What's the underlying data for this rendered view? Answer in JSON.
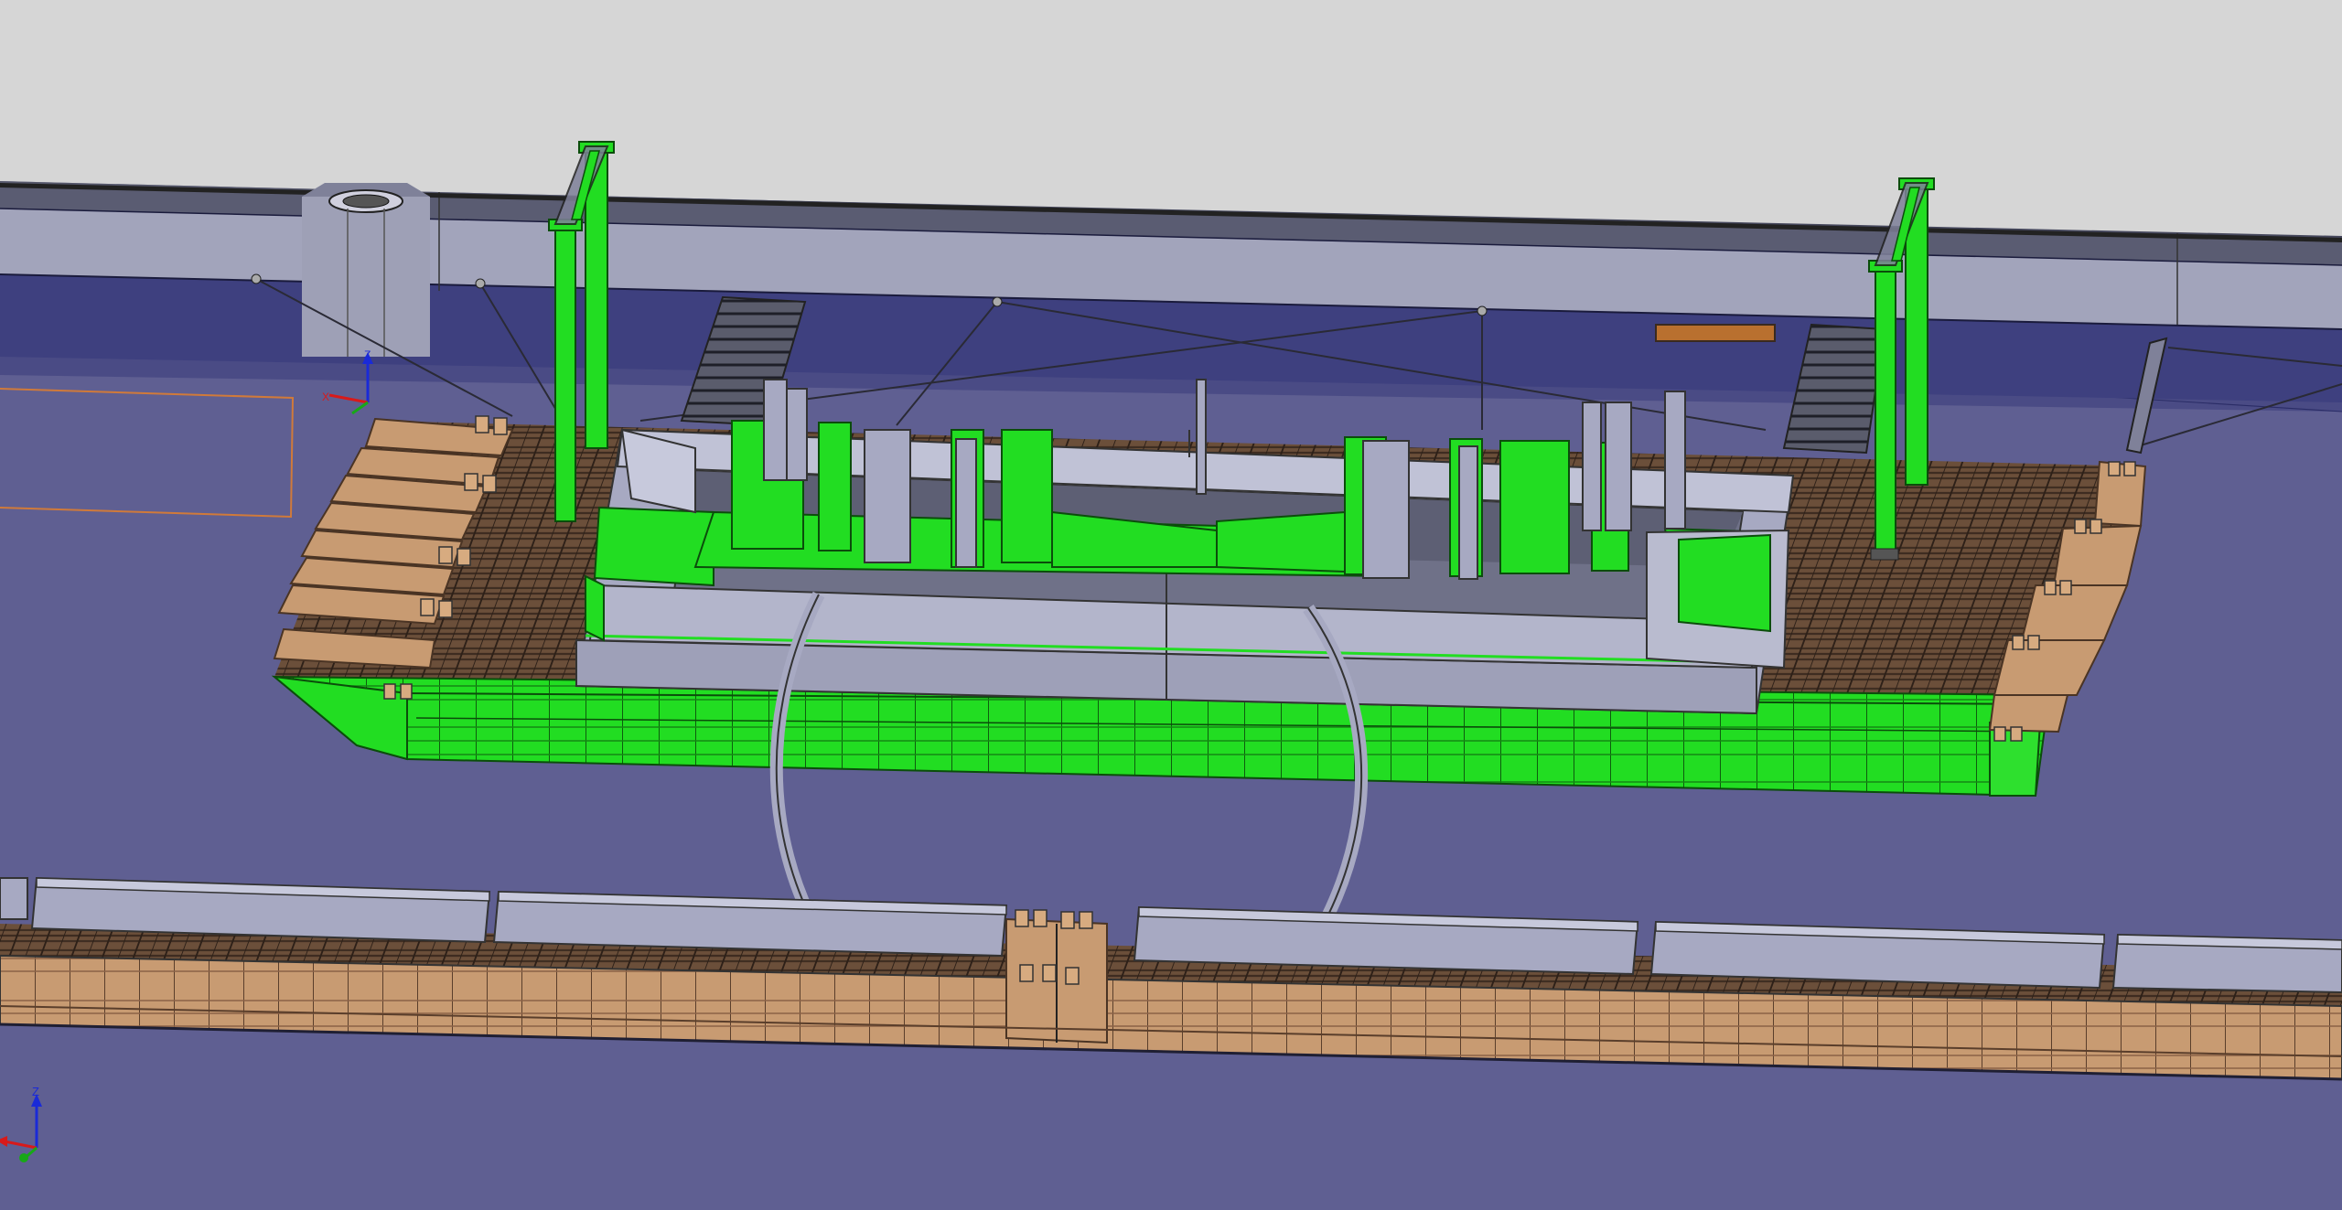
{
  "app": {
    "title": "",
    "mode": "3d-cad-viewport"
  },
  "viewport": {
    "background_sky": "#d6d6d6",
    "background_floor": "#5f5f92",
    "selection_color": "#22e022",
    "metal_color": "#a7a9c2",
    "timber_color": "#c79b72",
    "dark_steel_color": "#55576a"
  },
  "axis_triad_main": {
    "labels": [
      "Z",
      "Y",
      "X"
    ],
    "icon": "axis-triad-icon"
  },
  "axis_triad_local": {
    "labels": [
      "Z",
      "Y",
      "X"
    ],
    "icon": "axis-triad-icon"
  },
  "model": {
    "selected_assembly": "barge-with-lifting-frame",
    "selected_state": "highlighted",
    "pontoon_row": "timber-pontoons",
    "pier": "quay-wall-with-bollard"
  }
}
